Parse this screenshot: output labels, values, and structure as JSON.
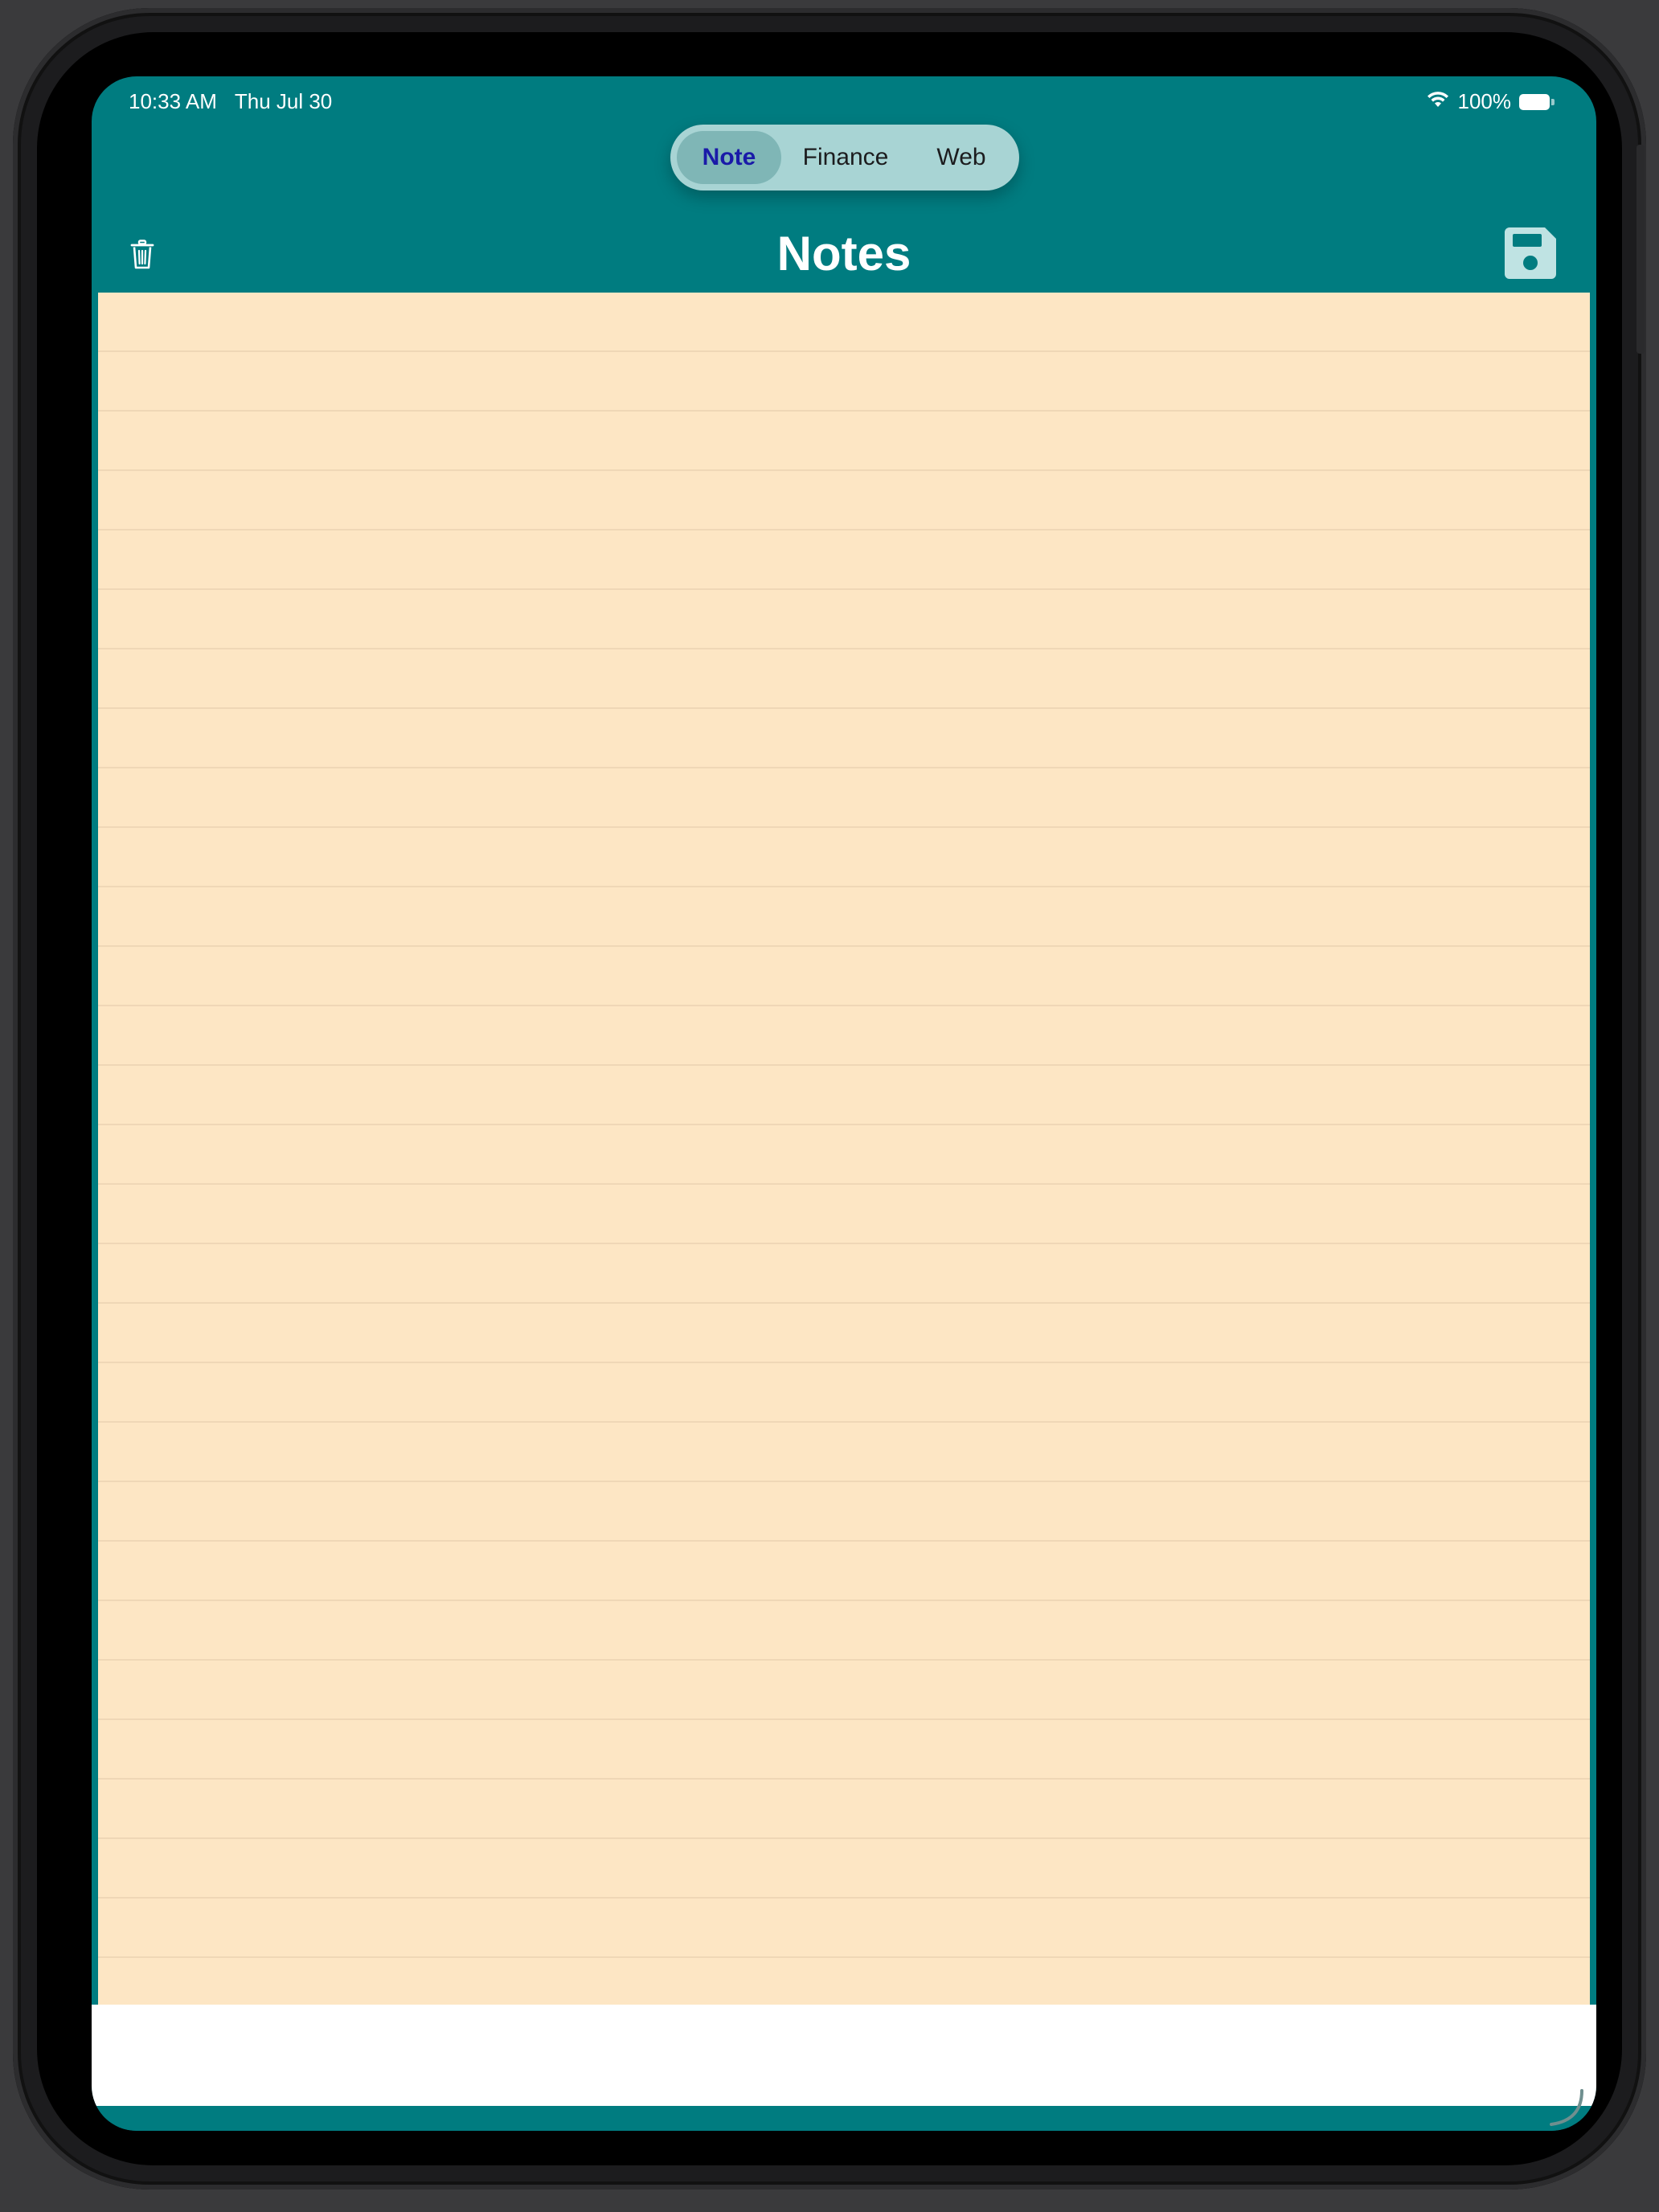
{
  "status_bar": {
    "time": "10:33 AM",
    "date": "Thu Jul 30",
    "battery": "100%"
  },
  "segmented_control": {
    "items": [
      {
        "label": "Note",
        "selected": true
      },
      {
        "label": "Finance",
        "selected": false
      },
      {
        "label": "Web",
        "selected": false
      }
    ]
  },
  "nav_bar": {
    "title": "Notes",
    "left_icon": "trash-icon",
    "right_icon": "floppy-disk-save-icon"
  },
  "note": {
    "text": ""
  },
  "colors": {
    "accent": "#007c80",
    "paper": "#fde6c4",
    "paper_line": "#efd7b6",
    "selected_segment_text": "#1a1aa8",
    "segment_background": "#a8d4d4",
    "bottom_panel": "#ffffff"
  }
}
